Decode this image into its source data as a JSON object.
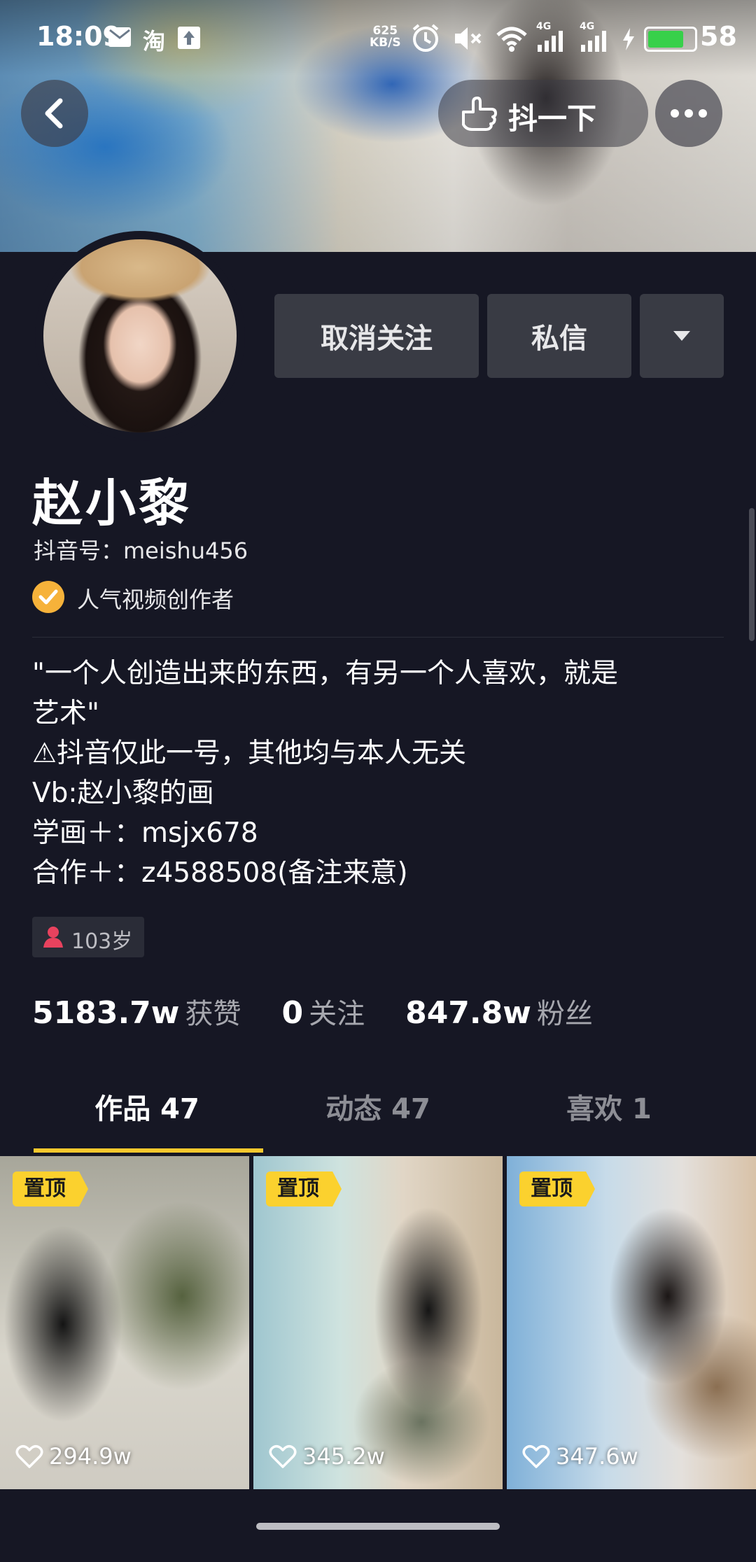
{
  "status_bar": {
    "time": "18:09",
    "notif_icons": [
      "mail-icon",
      "taobao-icon",
      "upload-icon"
    ],
    "net_speed_value": "625",
    "net_speed_unit": "KB/S",
    "signal_labels": [
      "4G",
      "4G"
    ],
    "battery": "58"
  },
  "header": {
    "shake_label": "抖一下"
  },
  "profile": {
    "buttons": {
      "unfollow": "取消关注",
      "message": "私信"
    },
    "name": "赵小黎",
    "douyin_id": "抖音号：meishu456",
    "verification": "人气视频创作者",
    "bio": [
      "\"一个人创造出来的东西，有另一个人喜欢，就是",
      "艺术\"",
      "⚠抖音仅此一号，其他均与本人无关",
      "Vb:赵小黎的画",
      "学画＋：msjx678",
      "合作＋：z4588508(备注来意)"
    ],
    "age_tag": "103岁",
    "stats": [
      {
        "num": "5183.7w",
        "label": "获赞"
      },
      {
        "num": "0",
        "label": "关注"
      },
      {
        "num": "847.8w",
        "label": "粉丝"
      }
    ]
  },
  "tabs": [
    {
      "label": "作品 47",
      "active": true
    },
    {
      "label": "动态 47",
      "active": false
    },
    {
      "label": "喜欢 1",
      "active": false
    }
  ],
  "videos": [
    {
      "pinned_label": "置顶",
      "likes": "294.9w"
    },
    {
      "pinned_label": "置顶",
      "likes": "345.2w"
    },
    {
      "pinned_label": "置顶",
      "likes": "347.6w"
    }
  ],
  "colors": {
    "background": "#161724",
    "button": "#393b44",
    "accent_yellow": "#fac82d",
    "verify_orange": "#f6b23a"
  }
}
